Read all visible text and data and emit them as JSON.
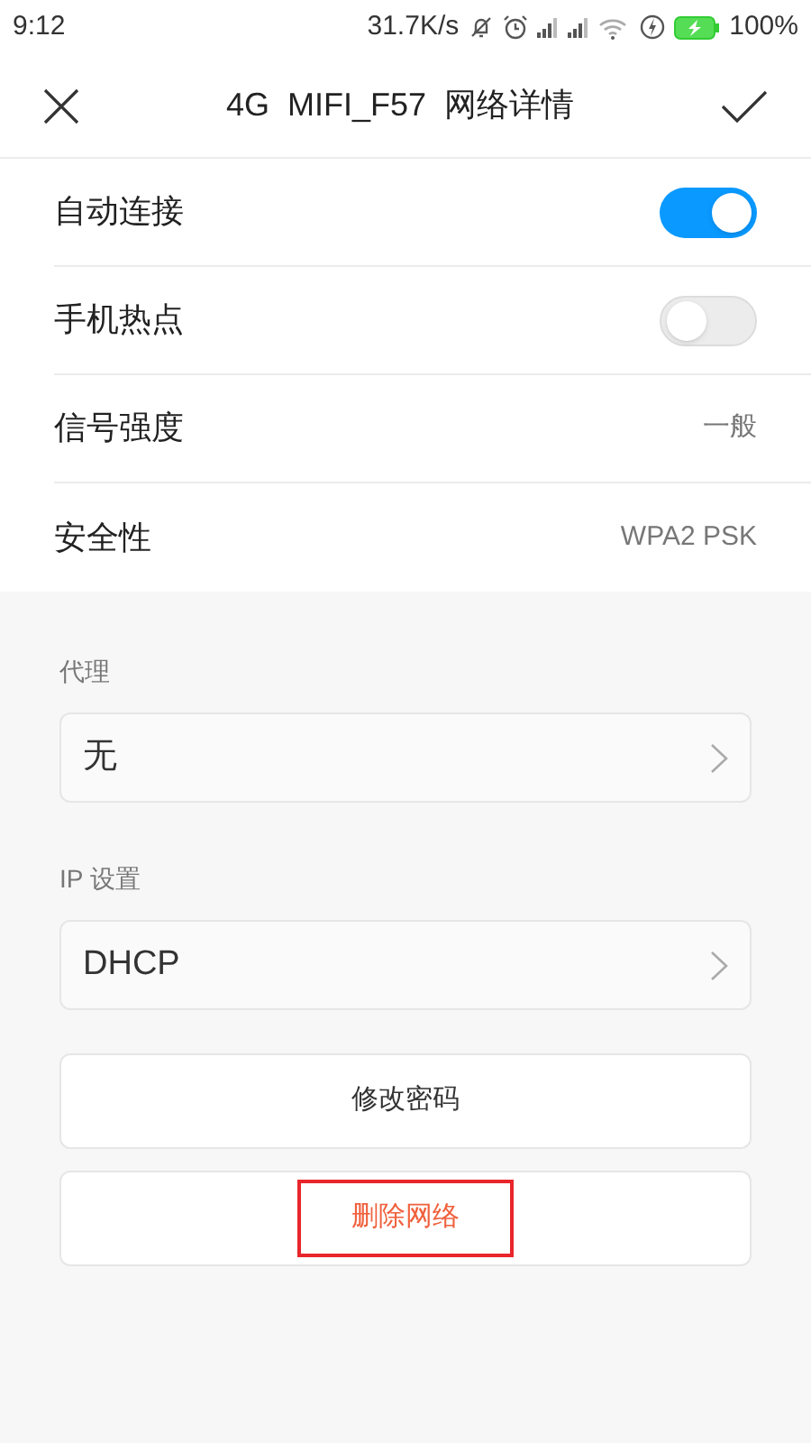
{
  "status_bar": {
    "time": "9:12",
    "speed": "31.7K/s",
    "battery": "100%"
  },
  "header": {
    "title": "4G  MIFI_F57  网络详情"
  },
  "rows": [
    {
      "kind": "toggle",
      "label": "自动连接",
      "on": true
    },
    {
      "kind": "toggle",
      "label": "手机热点",
      "on": false
    },
    {
      "kind": "value",
      "label": "信号强度",
      "value": "一般"
    },
    {
      "kind": "value",
      "label": "安全性",
      "value": "WPA2 PSK"
    }
  ],
  "selects": [
    {
      "label": "代理",
      "value": "无"
    },
    {
      "label": "IP 设置",
      "value": "DHCP"
    }
  ],
  "buttons": [
    {
      "kind": "normal",
      "label": "修改密码",
      "highlighted": false
    },
    {
      "kind": "danger",
      "label": "删除网络",
      "highlighted": true
    }
  ]
}
